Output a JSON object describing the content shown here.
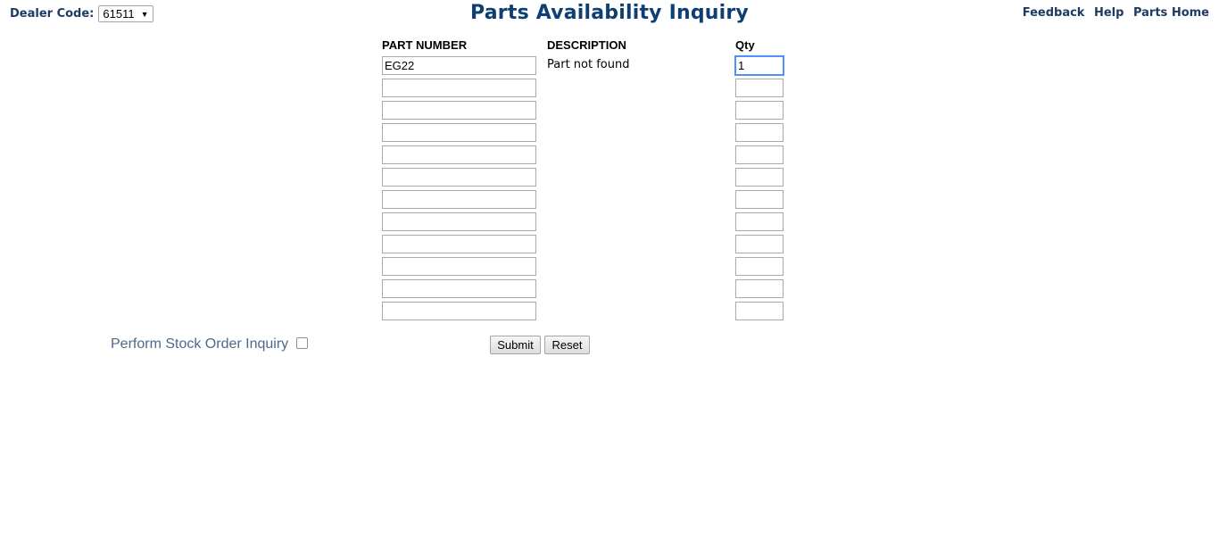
{
  "dealer": {
    "label": "Dealer Code:",
    "selected": "61511",
    "caret": "▼"
  },
  "title": "Parts Availability Inquiry",
  "links": {
    "feedback": "Feedback",
    "help": "Help",
    "parts_home": "Parts Home"
  },
  "columns": {
    "part_number": "PART NUMBER",
    "description": "DESCRIPTION",
    "qty": "Qty"
  },
  "rows": [
    {
      "part": "EG22",
      "description": "Part not found",
      "qty": "1"
    },
    {
      "part": "",
      "description": "",
      "qty": ""
    },
    {
      "part": "",
      "description": "",
      "qty": ""
    },
    {
      "part": "",
      "description": "",
      "qty": ""
    },
    {
      "part": "",
      "description": "",
      "qty": ""
    },
    {
      "part": "",
      "description": "",
      "qty": ""
    },
    {
      "part": "",
      "description": "",
      "qty": ""
    },
    {
      "part": "",
      "description": "",
      "qty": ""
    },
    {
      "part": "",
      "description": "",
      "qty": ""
    },
    {
      "part": "",
      "description": "",
      "qty": ""
    },
    {
      "part": "",
      "description": "",
      "qty": ""
    },
    {
      "part": "",
      "description": "",
      "qty": ""
    }
  ],
  "stock_inquiry": {
    "label": "Perform Stock Order Inquiry",
    "checked": false
  },
  "buttons": {
    "submit": "Submit",
    "reset": "Reset"
  },
  "colors": {
    "title": "#0e3f73",
    "header_text": "#1f3b63",
    "stock_label": "#4c6a8c",
    "focus_border": "#4d90fe"
  }
}
